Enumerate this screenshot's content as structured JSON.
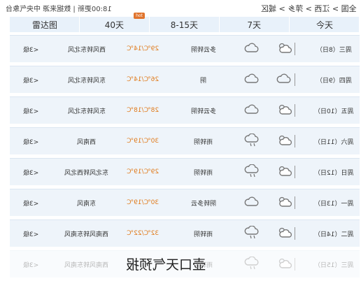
{
  "header": {
    "breadcrumb": "全国 > 江西 > 萍乡 > 城区",
    "updated": "18:00更新 | 数据来源 中央气象台"
  },
  "tabs": [
    {
      "label": "今天"
    },
    {
      "label": "7天"
    },
    {
      "label": "8-15天"
    },
    {
      "label": "40天",
      "badge": "hot"
    },
    {
      "label": "雷达图"
    }
  ],
  "forecast": [
    {
      "day": "周三（8日）",
      "weather": "多云转阴",
      "temp": "29℃/14℃",
      "wind_dir": "西风转东北风",
      "wind_level": "<3级"
    },
    {
      "day": "周四（9日）",
      "weather": "阴",
      "temp": "26℃/14℃",
      "wind_dir": "东风转东北风",
      "wind_level": "<3级"
    },
    {
      "day": "周五（10日）",
      "weather": "多云转阴",
      "temp": "28℃/18℃",
      "wind_dir": "东风转东北风",
      "wind_level": "<3级"
    },
    {
      "day": "周六（11日）",
      "weather": "雨转阴",
      "temp": "30℃/19℃",
      "wind_dir": "西南风",
      "wind_level": "<3级"
    },
    {
      "day": "周日（12日）",
      "weather": "雨转阴",
      "temp": "29℃/19℃",
      "wind_dir": "东北风转西北风",
      "wind_level": "<3级"
    },
    {
      "day": "周一（13日）",
      "weather": "阴转多云",
      "temp": "30℃/19℃",
      "wind_dir": "东南风",
      "wind_level": "<3级"
    },
    {
      "day": "周二（14日）",
      "weather": "雨转阴",
      "temp": "32℃/22℃",
      "wind_dir": "西南风转东南风",
      "wind_level": "<3级"
    },
    {
      "day": "周三（15日）",
      "weather": "雨转阴",
      "temp": "",
      "wind_dir": "西南风转东南风",
      "wind_level": "<3级"
    }
  ],
  "caption": "壶口天气预报",
  "colors": {
    "accent_temp": "#e07a1a",
    "tab_bg": "#e8f1fa",
    "row_bg": "#eef4fa"
  }
}
